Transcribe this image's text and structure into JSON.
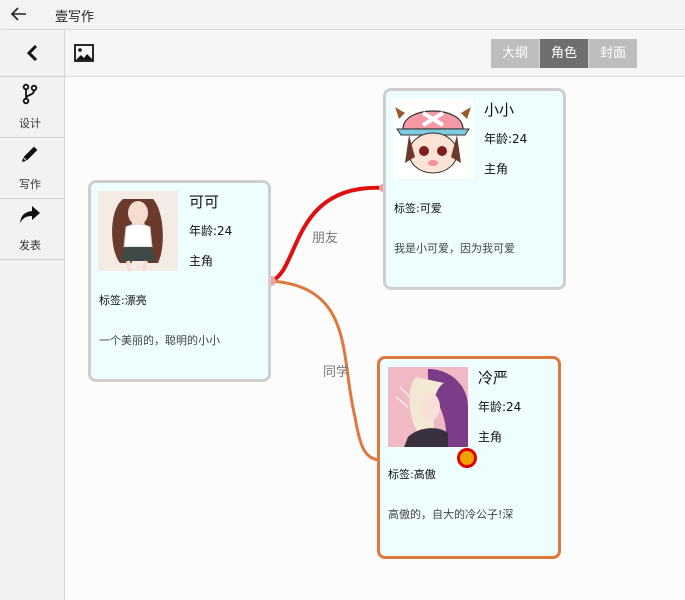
{
  "app": {
    "title": "壹写作"
  },
  "sidebar": {
    "items": [
      {
        "label": "设计",
        "icon": "branch-icon"
      },
      {
        "label": "写作",
        "icon": "pencil-icon"
      },
      {
        "label": "发表",
        "icon": "share-arrow-icon"
      }
    ]
  },
  "toolbar": {
    "tabs": [
      "大纲",
      "角色",
      "封面"
    ],
    "active_tab": "角色"
  },
  "characters": [
    {
      "name": "可可",
      "age": "年龄:24",
      "role": "主角",
      "tag": "标签:漂亮",
      "desc": "一个美丽的，聪明的小小"
    },
    {
      "name": "小小",
      "age": "年龄:24",
      "role": "主角",
      "tag": "标签:可爱",
      "desc": "我是小可爱，因为我可爱"
    },
    {
      "name": "冷严",
      "age": "年龄:24",
      "role": "主角",
      "tag": "标签:高傲",
      "desc": "高傲的，自大的冷公子!深"
    }
  ],
  "relations": [
    {
      "label": "朋友",
      "color": "#e01010"
    },
    {
      "label": "同学",
      "color": "#e0783e"
    }
  ],
  "colors": {
    "selected_border": "#e0783e",
    "card_background": "#eefeff",
    "active_tab": "#6e6e6e",
    "inactive_tab": "#bdbdbd"
  }
}
